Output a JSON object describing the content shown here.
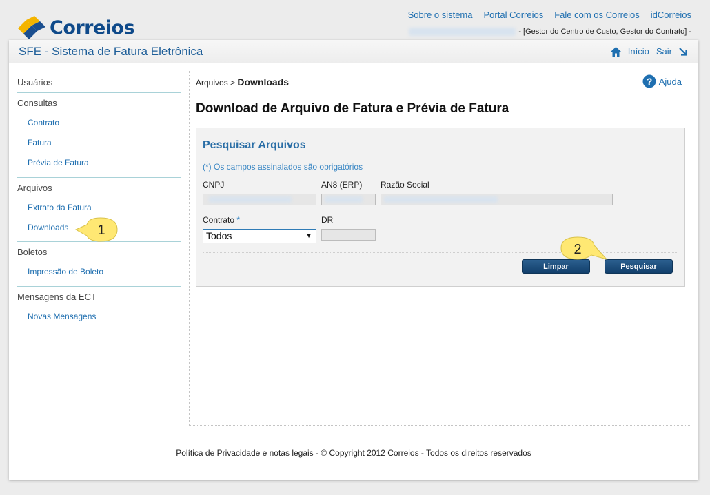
{
  "header": {
    "logo_text": "Correios",
    "top_links": [
      "Sobre o sistema",
      "Portal Correios",
      "Fale com os Correios",
      "idCorreios"
    ],
    "user_roles": "- [Gestor do Centro de Custo, Gestor do Contrato] -"
  },
  "titlebar": {
    "app_title": "SFE - Sistema de Fatura Eletrônica",
    "home_label": "Início",
    "logout_label": "Sair"
  },
  "sidebar": {
    "sections": [
      {
        "label": "Usuários",
        "items": []
      },
      {
        "label": "Consultas",
        "items": [
          "Contrato",
          "Fatura",
          "Prévia de Fatura"
        ]
      },
      {
        "label": "Arquivos",
        "items": [
          "Extrato da Fatura",
          "Downloads"
        ]
      },
      {
        "label": "Boletos",
        "items": [
          "Impressão de Boleto"
        ]
      },
      {
        "label": "Mensagens da ECT",
        "items": [
          "Novas Mensagens"
        ]
      }
    ]
  },
  "content": {
    "breadcrumb_parent": "Arquivos",
    "breadcrumb_sep": ">",
    "breadcrumb_current": "Downloads",
    "help_label": "Ajuda",
    "page_title": "Download de Arquivo de Fatura e Prévia de Fatura",
    "search": {
      "title": "Pesquisar Arquivos",
      "required_note": "(*) Os campos assinalados são obrigatórios",
      "cnpj_label": "CNPJ",
      "an8_label": "AN8 (ERP)",
      "razao_label": "Razão Social",
      "contrato_label": "Contrato",
      "contrato_required": "*",
      "contrato_value": "Todos",
      "dr_label": "DR",
      "limpar_label": "Limpar",
      "pesquisar_label": "Pesquisar"
    }
  },
  "callouts": [
    "1",
    "2"
  ],
  "footer": {
    "text": "Política de Privacidade e notas legais - © Copyright 2012 Correios - Todos os direitos reservados"
  },
  "colors": {
    "link": "#1f6fb0",
    "button": "#1a4a78",
    "callout": "#ffe873",
    "sidebar_sep": "#a9d2d8"
  }
}
